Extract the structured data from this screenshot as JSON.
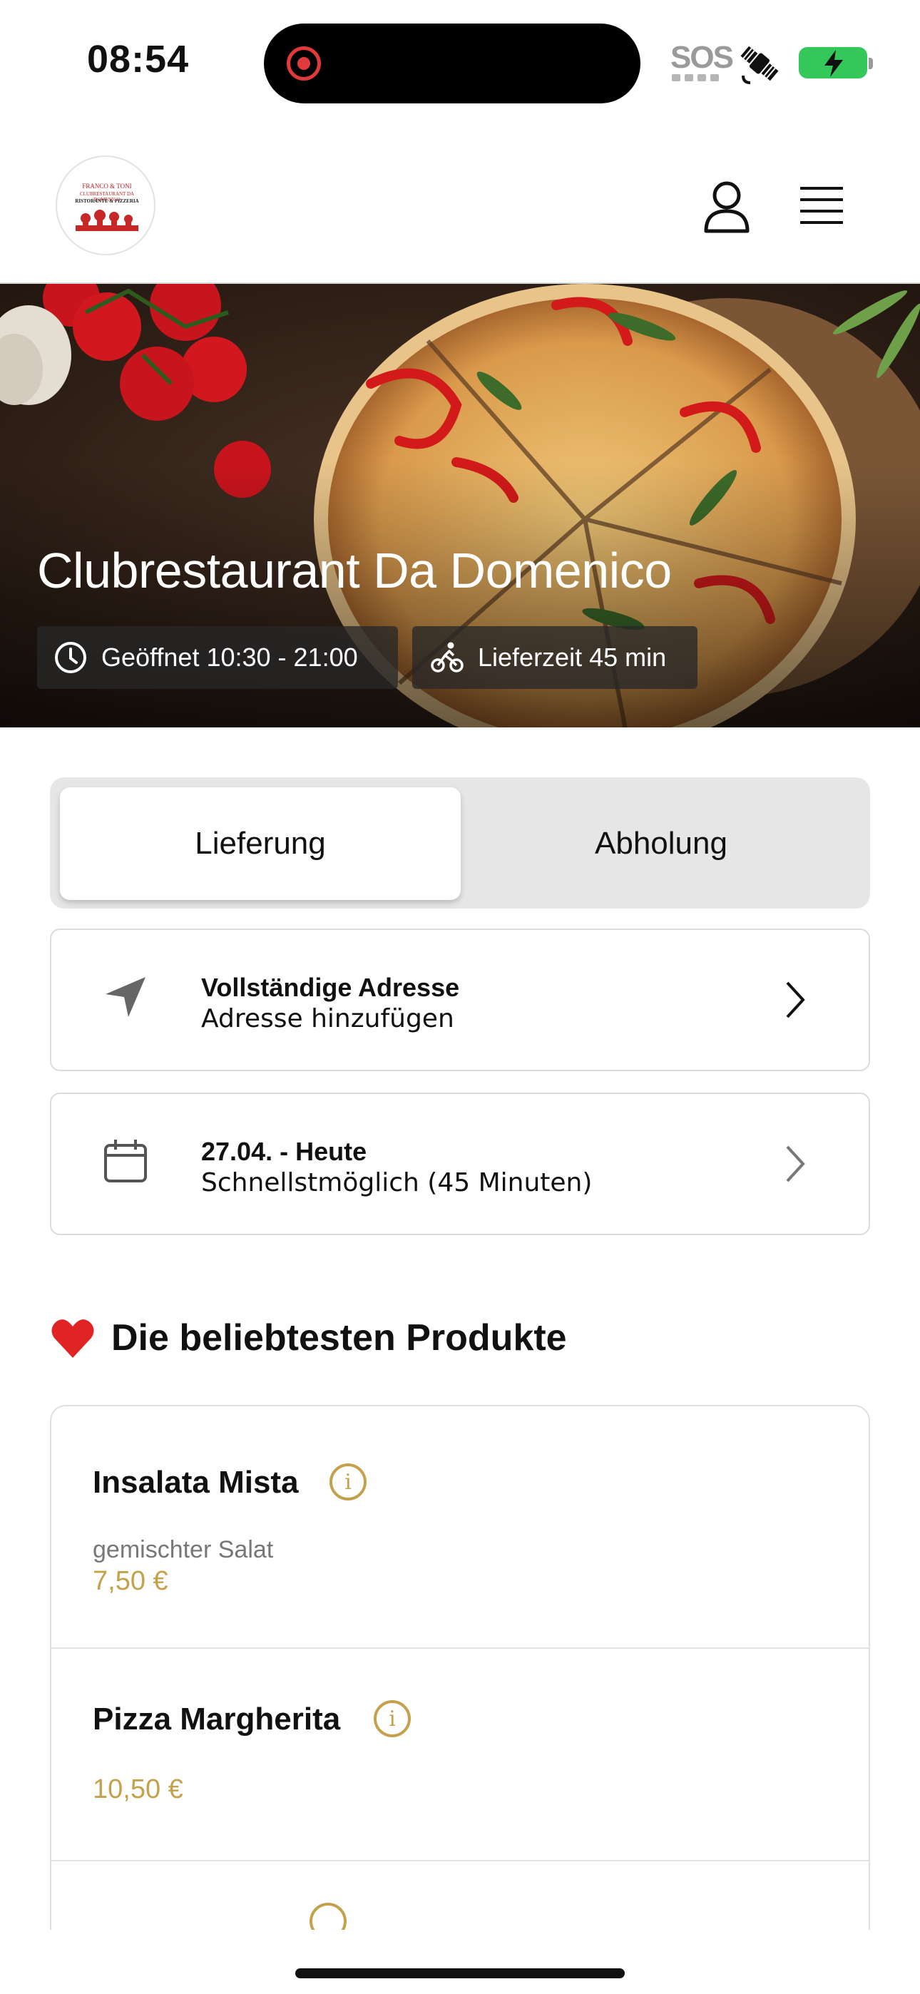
{
  "status_bar": {
    "time": "08:54",
    "sos": "SOS",
    "icons": [
      "recording-indicator-icon",
      "satellite-icon",
      "battery-charging-icon"
    ]
  },
  "header": {
    "logo": {
      "line1": "FRANCO & TONI",
      "line2": "CLUBRESTAURANT DA DOMENICO",
      "line3": "RISTORANTE & PIZZERIA"
    },
    "icons": [
      "user-icon",
      "menu-icon"
    ]
  },
  "hero": {
    "title": "Clubrestaurant Da Domenico",
    "opening_hours": "Geöffnet 10:30 - 21:00",
    "delivery_time": "Lieferzeit 45 min"
  },
  "order_mode": {
    "options": [
      "Lieferung",
      "Abholung"
    ],
    "selected": "Lieferung"
  },
  "address_card": {
    "title": "Vollständige Adresse",
    "subtitle": "Adresse hinzufügen",
    "icon": "location-arrow-icon"
  },
  "date_card": {
    "title": "27.04. - Heute",
    "subtitle": "Schnellstmöglich (45 Minuten)",
    "icon": "calendar-icon"
  },
  "popular": {
    "title": "Die beliebtesten Produkte",
    "icon": "heart-icon",
    "products": [
      {
        "name": "Insalata Mista",
        "description": "gemischter Salat",
        "price": "7,50 €"
      },
      {
        "name": "Pizza Margherita",
        "description": "",
        "price": "10,50 €"
      }
    ]
  },
  "colors": {
    "accent_gold": "#c4a24c",
    "battery_green": "#34c759",
    "recording_red": "#e03a3a"
  }
}
